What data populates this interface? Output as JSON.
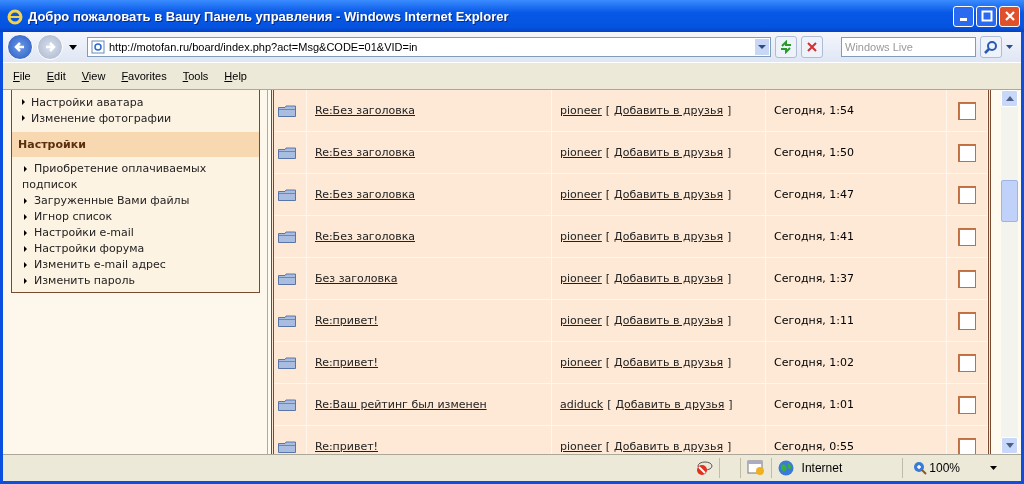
{
  "window": {
    "title": "Добро пожаловать в Вашу Панель управления - Windows Internet Explorer"
  },
  "address_bar": {
    "url": "http://motofan.ru/board/index.php?act=Msg&CODE=01&VID=in"
  },
  "search": {
    "placeholder": "Windows Live"
  },
  "menu": [
    "File",
    "Edit",
    "View",
    "Favorites",
    "Tools",
    "Help"
  ],
  "sidebar": {
    "top_items": [
      "Настройки аватара",
      "Изменение фотографии"
    ],
    "section": {
      "title": "Настройки",
      "items": [
        "Приобретение оплачиваемых подписок",
        "Загруженные Вами файлы",
        "Игнор список",
        "Настройки e-mail",
        "Настройки форума",
        "Изменить e-mail адрес",
        "Изменить пароль"
      ]
    }
  },
  "messages_brackets": {
    "open": "[",
    "close": "]"
  },
  "messages": [
    {
      "title": "Re:Без заголовка",
      "from": "pioneer",
      "add_friend": "Добавить в друзья",
      "date": "Сегодня, 1:54",
      "checked": false
    },
    {
      "title": "Re:Без заголовка",
      "from": "pioneer",
      "add_friend": "Добавить в друзья",
      "date": "Сегодня, 1:50",
      "checked": false
    },
    {
      "title": "Re:Без заголовка",
      "from": "pioneer",
      "add_friend": "Добавить в друзья",
      "date": "Сегодня, 1:47",
      "checked": false
    },
    {
      "title": "Re:Без заголовка",
      "from": "pioneer",
      "add_friend": "Добавить в друзья",
      "date": "Сегодня, 1:41",
      "checked": false
    },
    {
      "title": "Без заголовка",
      "from": "pioneer",
      "add_friend": "Добавить в друзья",
      "date": "Сегодня, 1:37",
      "checked": false
    },
    {
      "title": "Re:привет!",
      "from": "pioneer",
      "add_friend": "Добавить в друзья",
      "date": "Сегодня, 1:11",
      "checked": false
    },
    {
      "title": "Re:привет!",
      "from": "pioneer",
      "add_friend": "Добавить в друзья",
      "date": "Сегодня, 1:02",
      "checked": false
    },
    {
      "title": "Re:Ваш рейтинг был изменен",
      "from": "adiduck",
      "add_friend": "Добавить в друзья",
      "date": "Сегодня, 1:01",
      "checked": false
    },
    {
      "title": "Re:привет!",
      "from": "pioneer",
      "add_friend": "Добавить в друзья",
      "date": "Сегодня, 0:55",
      "checked": false
    }
  ],
  "status_bar": {
    "zone": "Internet",
    "zoom": "100%"
  }
}
